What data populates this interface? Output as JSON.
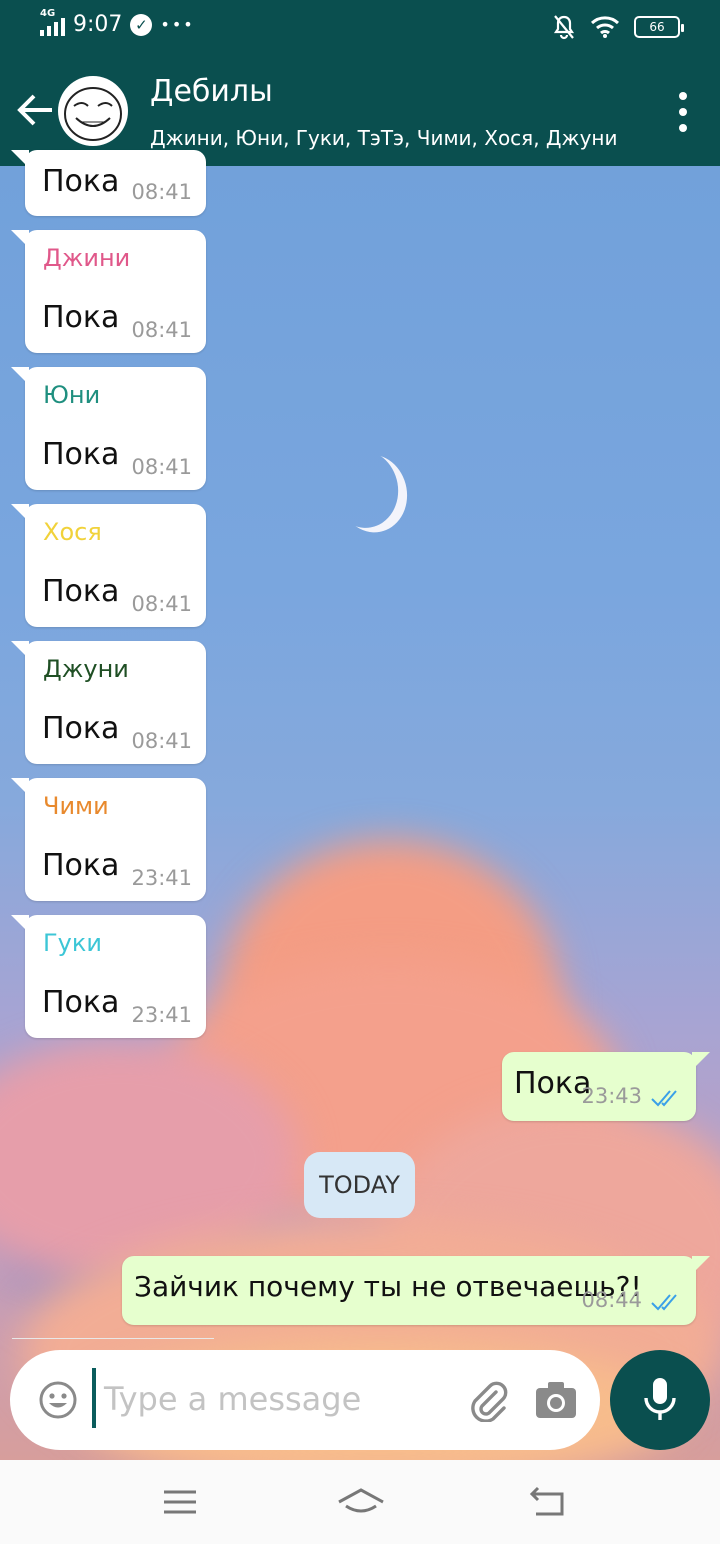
{
  "status_bar": {
    "network": "4G",
    "time": "9:07",
    "more": "•••",
    "battery": "66"
  },
  "header": {
    "title": "Дебилы",
    "subtitle": "Джини, Юни, Гуки, ТэТэ, Чими, Хося, Джуни"
  },
  "messages": [
    {
      "sender": "",
      "text": "Пока",
      "time": "08:41"
    },
    {
      "sender": "Джини",
      "sender_color": "#e0588a",
      "text": "Пока",
      "time": "08:41"
    },
    {
      "sender": "Юни",
      "sender_color": "#1f8f7f",
      "text": "Пока",
      "time": "08:41"
    },
    {
      "sender": "Хося",
      "sender_color": "#f1d23a",
      "text": "Пока",
      "time": "08:41"
    },
    {
      "sender": "Джуни",
      "sender_color": "#1f4f24",
      "text": "Пока",
      "time": "08:41"
    },
    {
      "sender": "Чими",
      "sender_color": "#e8892d",
      "text": "Пока",
      "time": "23:41"
    },
    {
      "sender": "Гуки",
      "sender_color": "#3cc6d6",
      "text": "Пока",
      "time": "23:41"
    }
  ],
  "outgoing": [
    {
      "text": "Пока",
      "time": "23:43"
    },
    {
      "text": "Зайчик почему ты не отвечаешь?!",
      "time": "08:44"
    }
  ],
  "date_divider": "TODAY",
  "composer": {
    "placeholder": "Type a message"
  },
  "colors": {
    "primary": "#0a4f4f",
    "outgoing_bubble": "#e6ffce",
    "read_ticks": "#3aa0e8"
  }
}
